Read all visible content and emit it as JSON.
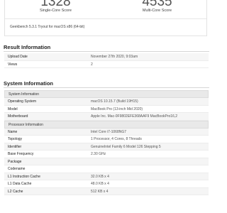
{
  "scores": {
    "single_core_value": "1328",
    "single_core_label": "Single-Core Score",
    "multi_core_value": "4535",
    "multi_core_label": "Multi-Core Score",
    "footer": "Geekbench 5.3.1 Tryout for macOS x86 (64-bit)"
  },
  "result_information": {
    "title": "Result Information",
    "rows": [
      {
        "key": "Upload Date",
        "value": "November 27th 2020, 9:03am"
      },
      {
        "key": "Views",
        "value": "2"
      }
    ]
  },
  "system_information": {
    "title": "System Information",
    "system_header": "System Information",
    "system_rows": [
      {
        "key": "Operating System",
        "value": "macOS 10.15.7 (Build 19H15)"
      },
      {
        "key": "Model",
        "value": "MacBook Pro (13-inch Mid 2020)"
      },
      {
        "key": "Motherboard",
        "value": "Apple Inc. Mac-0F9802EFE368AAF9 MacBookPro16,2"
      }
    ],
    "processor_header": "Processor Information",
    "processor_rows": [
      {
        "key": "Name",
        "value": "Intel Core i7-1068NG7"
      },
      {
        "key": "Topology",
        "value": "1 Processor, 4 Cores, 8 Threads"
      },
      {
        "key": "Identifier",
        "value": "GenuineIntel Family 6 Model 126 Stepping 5"
      },
      {
        "key": "Base Frequency",
        "value": "2.30 GHz"
      },
      {
        "key": "Package",
        "value": ""
      },
      {
        "key": "Codename",
        "value": ""
      },
      {
        "key": "L1 Instruction Cache",
        "value": "32.0 KB x 4"
      },
      {
        "key": "L1 Data Cache",
        "value": "48.0 KB x 4"
      },
      {
        "key": "L2 Cache",
        "value": "512 KB x 4"
      }
    ]
  }
}
